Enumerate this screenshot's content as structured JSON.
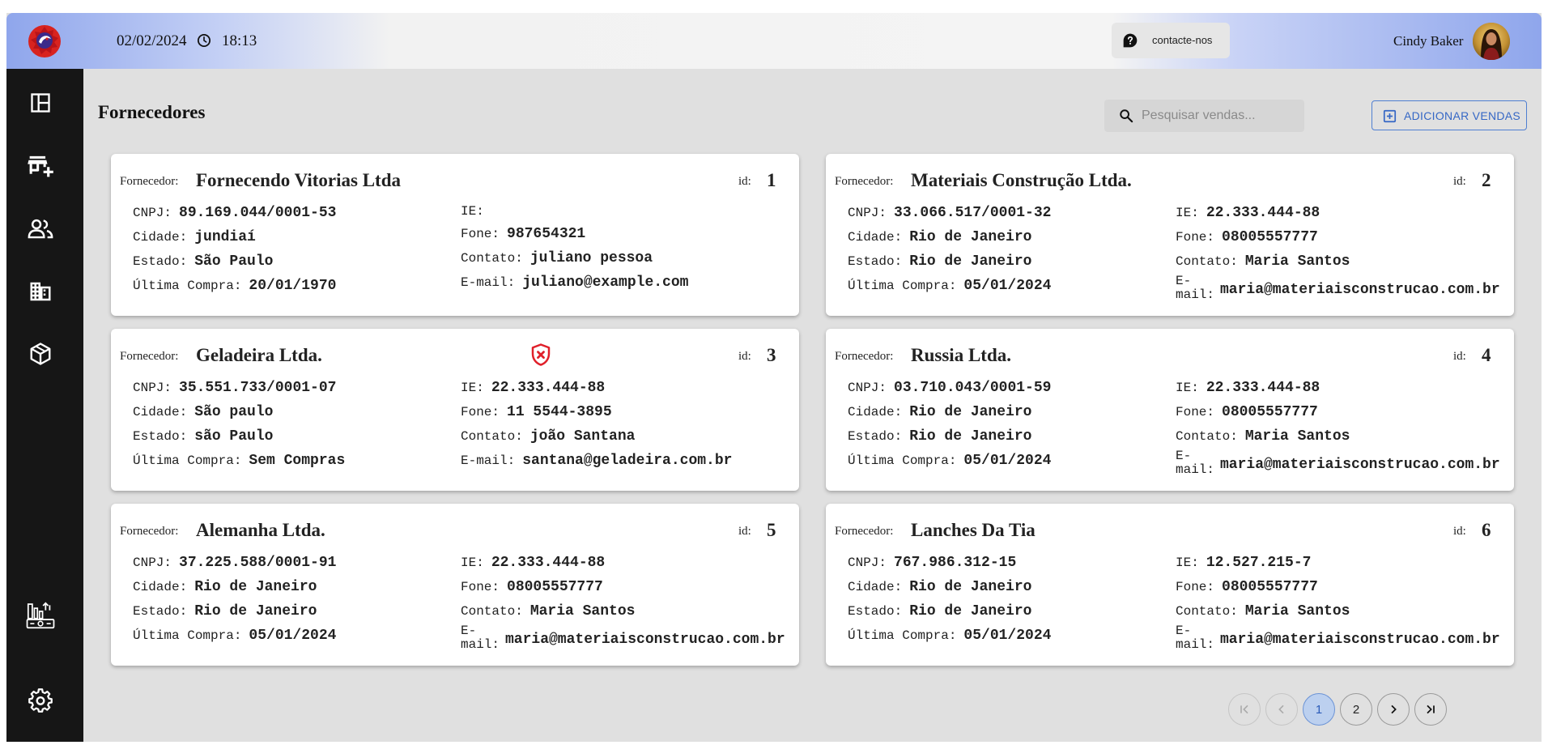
{
  "header": {
    "date": "02/02/2024",
    "time": "18:13",
    "contact_label": "contacte-nos",
    "user_name": "Cindy Baker"
  },
  "sidebar": {
    "items": [
      "dashboard-icon",
      "add-product-icon",
      "users-icon",
      "buildings-icon",
      "package-icon",
      "cash-register-icon",
      "gear-icon"
    ]
  },
  "main": {
    "title": "Fornecedores",
    "search_placeholder": "Pesquisar vendas...",
    "add_button_label": "ADICIONAR VENDAS"
  },
  "labels": {
    "fornecedor": "Fornecedor:",
    "id": "id:",
    "cnpj": "CNPJ:",
    "cidade": "Cidade:",
    "estado": "Estado:",
    "ultima_compra": "Última Compra:",
    "ie": "IE:",
    "fone": "Fone:",
    "contato": "Contato:",
    "email": "E-mail:"
  },
  "suppliers": [
    {
      "name": "Fornecendo Vitorias Ltda",
      "id": "1",
      "cnpj": "89.169.044/0001-53",
      "cidade": "jundiaí",
      "estado": "São Paulo",
      "ultima_compra": "20/01/1970",
      "ie": "",
      "fone": "987654321",
      "contato": "juliano pessoa",
      "email": "juliano@example.com"
    },
    {
      "name": "Materiais Construção Ltda.",
      "id": "2",
      "cnpj": "33.066.517/0001-32",
      "cidade": "Rio de Janeiro",
      "estado": "Rio de Janeiro",
      "ultima_compra": "05/01/2024",
      "ie": "22.333.444-88",
      "fone": "08005557777",
      "contato": "Maria Santos",
      "email": "maria@materiaisconstrucao.com.br"
    },
    {
      "name": "Geladeira Ltda.",
      "id": "3",
      "cnpj": "35.551.733/0001-07",
      "cidade": "São paulo",
      "estado": "são Paulo",
      "ultima_compra": "Sem Compras",
      "ie": "22.333.444-88",
      "fone": "11 5544-3895",
      "contato": "joão Santana",
      "email": "santana@geladeira.com.br"
    },
    {
      "name": "Russia Ltda.",
      "id": "4",
      "cnpj": "03.710.043/0001-59",
      "cidade": "Rio de Janeiro",
      "estado": "Rio de Janeiro",
      "ultima_compra": "05/01/2024",
      "ie": "22.333.444-88",
      "fone": "08005557777",
      "contato": "Maria Santos",
      "email": "maria@materiaisconstrucao.com.br"
    },
    {
      "name": "Alemanha Ltda.",
      "id": "5",
      "cnpj": "37.225.588/0001-91",
      "cidade": "Rio de Janeiro",
      "estado": "Rio de Janeiro",
      "ultima_compra": "05/01/2024",
      "ie": "22.333.444-88",
      "fone": "08005557777",
      "contato": "Maria Santos",
      "email": "maria@materiaisconstrucao.com.br"
    },
    {
      "name": "Lanches Da Tia",
      "id": "6",
      "cnpj": "767.986.312-15",
      "cidade": "Rio de Janeiro",
      "estado": "Rio de Janeiro",
      "ultima_compra": "05/01/2024",
      "ie": "12.527.215-7",
      "fone": "08005557777",
      "contato": "Maria Santos",
      "email": "maria@materiaisconstrucao.com.br"
    }
  ],
  "pagination": {
    "pages": [
      "1",
      "2"
    ],
    "current": "1"
  },
  "colors": {
    "sidebar": "#161616",
    "accent": "#3567c5",
    "alert": "#e0202a"
  }
}
